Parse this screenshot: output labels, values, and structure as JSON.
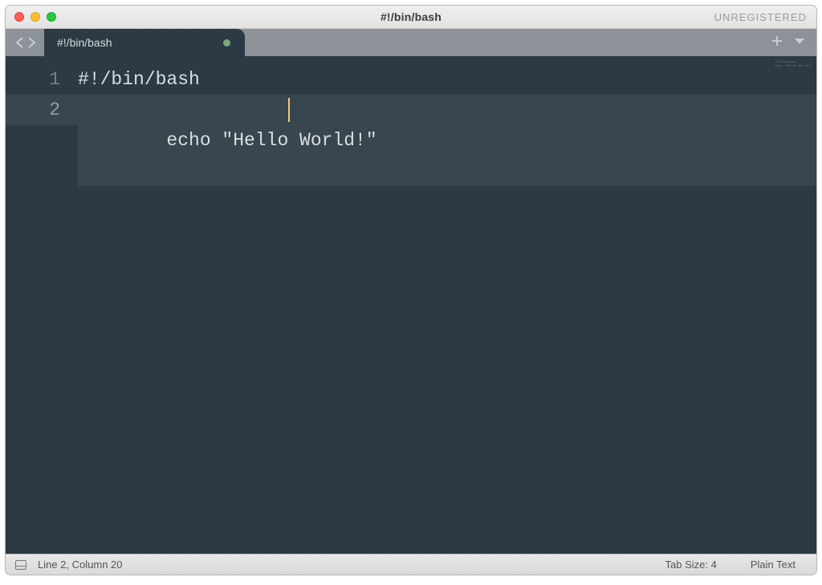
{
  "window": {
    "title": "#!/bin/bash",
    "registration_state": "UNREGISTERED"
  },
  "tabs": [
    {
      "title": "#!/bin/bash",
      "dirty": true
    }
  ],
  "editor": {
    "lines": [
      {
        "number": "1",
        "text": "#!/bin/bash"
      },
      {
        "number": "2",
        "text": "echo \"Hello World!\""
      }
    ],
    "cursor": {
      "line": 2,
      "column": 20
    }
  },
  "statusbar": {
    "position_label": "Line 2, Column 20",
    "tab_size_label": "Tab Size: 4",
    "syntax_label": "Plain Text"
  },
  "icons": {
    "nav_back": "nav-back-icon",
    "nav_forward": "nav-forward-icon",
    "new_tab": "plus-icon",
    "tab_menu": "triangle-down-icon"
  },
  "colors": {
    "editor_bg": "#2b3a44",
    "tabbar_bg": "#8d9198",
    "text": "#d9dedf",
    "cursor": "#f6c97b"
  }
}
